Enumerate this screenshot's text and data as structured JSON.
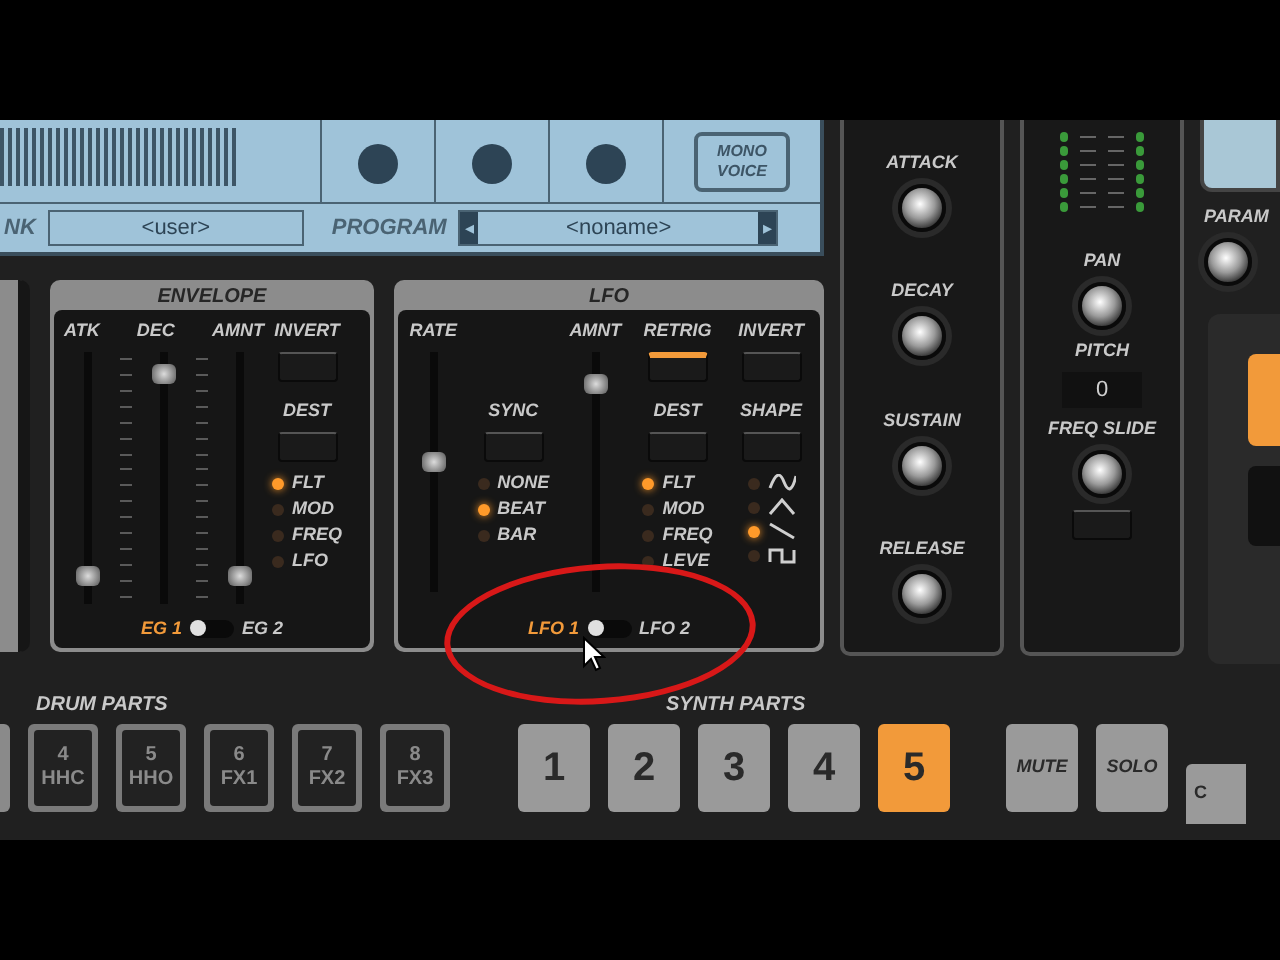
{
  "lcd": {
    "mono_voice": "MONO VOICE",
    "bank_label": "NK",
    "bank_value": "<user>",
    "program_label": "PROGRAM",
    "program_prev": "◂",
    "program_value": "<noname>",
    "program_next": "▸"
  },
  "envelope": {
    "title": "ENVELOPE",
    "sliders": [
      {
        "label": "ATK",
        "level": 0.08
      },
      {
        "label": "DEC",
        "level": 0.95
      },
      {
        "label": "AMNT",
        "level": 0.08
      }
    ],
    "invert": {
      "label": "INVERT",
      "on": false
    },
    "dest_label": "DEST",
    "dest_options": [
      {
        "label": "FLT",
        "on": true
      },
      {
        "label": "MOD",
        "on": false
      },
      {
        "label": "FREQ",
        "on": false
      },
      {
        "label": "LFO",
        "on": false
      }
    ],
    "toggle": [
      {
        "label": "EG 1",
        "selected": true
      },
      {
        "label": "EG 2",
        "selected": false
      }
    ]
  },
  "lfo": {
    "title": "LFO",
    "rate": {
      "label": "RATE",
      "level": 0.55
    },
    "amnt": {
      "label": "AMNT",
      "level": 0.9
    },
    "retrig": {
      "label": "RETRIG",
      "on": true
    },
    "invert": {
      "label": "INVERT",
      "on": false
    },
    "sync_label": "SYNC",
    "sync_options": [
      {
        "label": "NONE",
        "on": false
      },
      {
        "label": "BEAT",
        "on": true
      },
      {
        "label": "BAR",
        "on": false
      }
    ],
    "dest_label": "DEST",
    "dest_options": [
      {
        "label": "FLT",
        "on": true
      },
      {
        "label": "MOD",
        "on": false
      },
      {
        "label": "FREQ",
        "on": false
      },
      {
        "label": "LEVE",
        "on": false
      }
    ],
    "shape_label": "SHAPE",
    "shapes": [
      {
        "kind": "sine",
        "on": false
      },
      {
        "kind": "triangle",
        "on": false
      },
      {
        "kind": "saw",
        "on": true
      },
      {
        "kind": "square",
        "on": false
      }
    ],
    "toggle": [
      {
        "label": "LFO 1",
        "selected": true
      },
      {
        "label": "LFO 2",
        "selected": false
      }
    ]
  },
  "amp_envelope": {
    "knobs": [
      "ATTACK",
      "DECAY",
      "SUSTAIN",
      "RELEASE"
    ]
  },
  "mixer": {
    "pan": "PAN",
    "pitch_label": "PITCH",
    "pitch_value": "0",
    "freq_slide": "FREQ SLIDE"
  },
  "right_panel": {
    "param": "PARAM"
  },
  "drum_parts": {
    "label": "DRUM PARTS",
    "buttons": [
      {
        "number": "4",
        "name": "HHC"
      },
      {
        "number": "5",
        "name": "HHO"
      },
      {
        "number": "6",
        "name": "FX1"
      },
      {
        "number": "7",
        "name": "FX2"
      },
      {
        "number": "8",
        "name": "FX3"
      }
    ]
  },
  "synth_parts": {
    "label": "SYNTH PARTS",
    "buttons": [
      {
        "label": "1",
        "selected": false
      },
      {
        "label": "2",
        "selected": false
      },
      {
        "label": "3",
        "selected": false
      },
      {
        "label": "4",
        "selected": false
      },
      {
        "label": "5",
        "selected": true
      }
    ]
  },
  "mute": "MUTE",
  "solo": "SOLO",
  "cut_button": "C"
}
